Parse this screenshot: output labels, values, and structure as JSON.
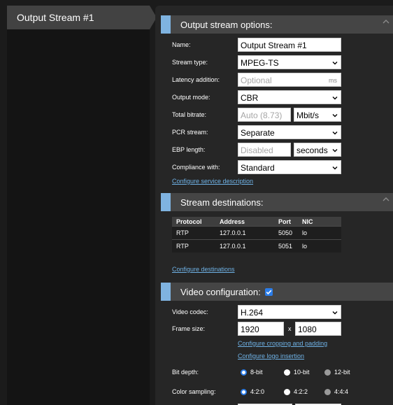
{
  "sidebar": {
    "items": [
      {
        "label": "Output Stream #1"
      }
    ]
  },
  "output_options": {
    "title": "Output stream options:",
    "fields": {
      "name": {
        "label": "Name:",
        "value": "Output Stream #1"
      },
      "stream_type": {
        "label": "Stream type:",
        "value": "MPEG-TS"
      },
      "latency": {
        "label": "Latency addition:",
        "placeholder": "Optional",
        "unit": "ms"
      },
      "output_mode": {
        "label": "Output mode:",
        "value": "CBR"
      },
      "total_bitrate": {
        "label": "Total bitrate:",
        "placeholder": "Auto (8.73)",
        "unit": "Mbit/s"
      },
      "pcr_stream": {
        "label": "PCR stream:",
        "value": "Separate"
      },
      "ebp_length": {
        "label": "EBP length:",
        "placeholder": "Disabled",
        "unit": "seconds"
      },
      "compliance": {
        "label": "Compliance with:",
        "value": "Standard"
      }
    },
    "link": "Configure service description"
  },
  "stream_destinations": {
    "title": "Stream destinations:",
    "columns": [
      "Protocol",
      "Address",
      "Port",
      "NIC"
    ],
    "rows": [
      [
        "RTP",
        "127.0.0.1",
        "5050",
        "lo"
      ],
      [
        "RTP",
        "127.0.0.1",
        "5051",
        "lo"
      ]
    ],
    "link": "Configure destinations"
  },
  "video_config": {
    "title": "Video configuration:",
    "enabled": true,
    "codec": {
      "label": "Video codec:",
      "value": "H.264"
    },
    "frame_size": {
      "label": "Frame size:",
      "width": "1920",
      "sep": "x",
      "height": "1080"
    },
    "link_crop": "Configure cropping and padding",
    "link_logo": "Configure logo insertion",
    "bit_depth": {
      "label": "Bit depth:",
      "options": [
        "8-bit",
        "10-bit",
        "12-bit"
      ],
      "selected": "8-bit"
    },
    "color_sampling": {
      "label": "Color sampling:",
      "options": [
        "4:2:0",
        "4:2:2",
        "4:4:4"
      ],
      "selected": "4:2:0"
    }
  },
  "colors": {
    "accent": "#7fb3e0",
    "link": "#6fb2e6",
    "radio_selected": "#2b7de9"
  }
}
